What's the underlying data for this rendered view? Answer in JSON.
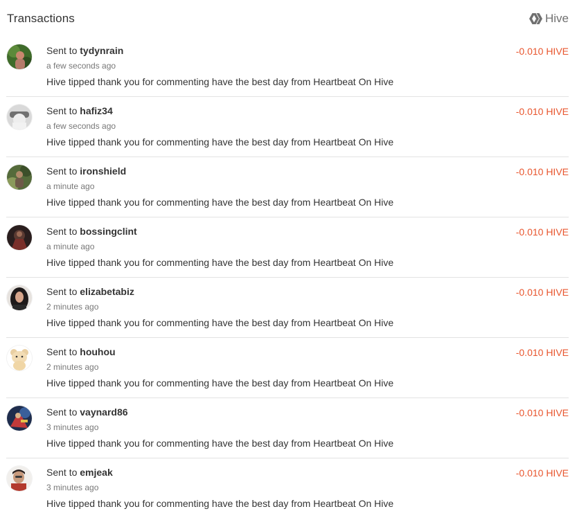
{
  "header": {
    "title": "Transactions",
    "brand": "Hive",
    "brand_icon": "hive-logo-icon"
  },
  "colors": {
    "amount": "#e8552d",
    "brand": "#707070"
  },
  "transactions": [
    {
      "prefix": "Sent to",
      "user": "tydynrain",
      "time": "a few seconds ago",
      "memo": "Hive tipped thank you for commenting have the best day from Heartbeat On Hive",
      "amount": "-0.010 HIVE"
    },
    {
      "prefix": "Sent to",
      "user": "hafiz34",
      "time": "a few seconds ago",
      "memo": "Hive tipped thank you for commenting have the best day from Heartbeat On Hive",
      "amount": "-0.010 HIVE"
    },
    {
      "prefix": "Sent to",
      "user": "ironshield",
      "time": "a minute ago",
      "memo": "Hive tipped thank you for commenting have the best day from Heartbeat On Hive",
      "amount": "-0.010 HIVE"
    },
    {
      "prefix": "Sent to",
      "user": "bossingclint",
      "time": "a minute ago",
      "memo": "Hive tipped thank you for commenting have the best day from Heartbeat On Hive",
      "amount": "-0.010 HIVE"
    },
    {
      "prefix": "Sent to",
      "user": "elizabetabiz",
      "time": "2 minutes ago",
      "memo": "Hive tipped thank you for commenting have the best day from Heartbeat On Hive",
      "amount": "-0.010 HIVE"
    },
    {
      "prefix": "Sent to",
      "user": "houhou",
      "time": "2 minutes ago",
      "memo": "Hive tipped thank you for commenting have the best day from Heartbeat On Hive",
      "amount": "-0.010 HIVE"
    },
    {
      "prefix": "Sent to",
      "user": "vaynard86",
      "time": "3 minutes ago",
      "memo": "Hive tipped thank you for commenting have the best day from Heartbeat On Hive",
      "amount": "-0.010 HIVE"
    },
    {
      "prefix": "Sent to",
      "user": "emjeak",
      "time": "3 minutes ago",
      "memo": "Hive tipped thank you for commenting have the best day from Heartbeat On Hive",
      "amount": "-0.010 HIVE"
    }
  ]
}
